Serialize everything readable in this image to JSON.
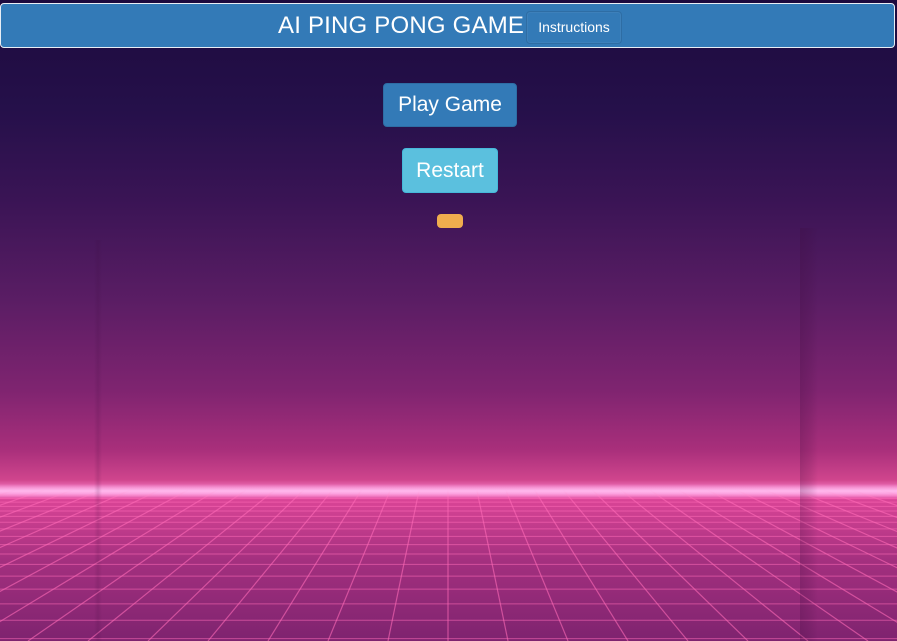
{
  "header": {
    "title": "AI PING PONG GAME",
    "instructions_label": "Instructions"
  },
  "controls": {
    "play_label": "Play Game",
    "restart_label": "Restart"
  },
  "colors": {
    "header_bar": "#337ab7",
    "play_button": "#337ab7",
    "restart_button": "#5bc0de",
    "ball": "#f0ad4e",
    "grid_lines": "#ff6bb8",
    "sky_top": "#1d0a3e",
    "horizon": "#ff8ad6"
  },
  "icons": {
    "background": "synthwave-grid-background"
  }
}
